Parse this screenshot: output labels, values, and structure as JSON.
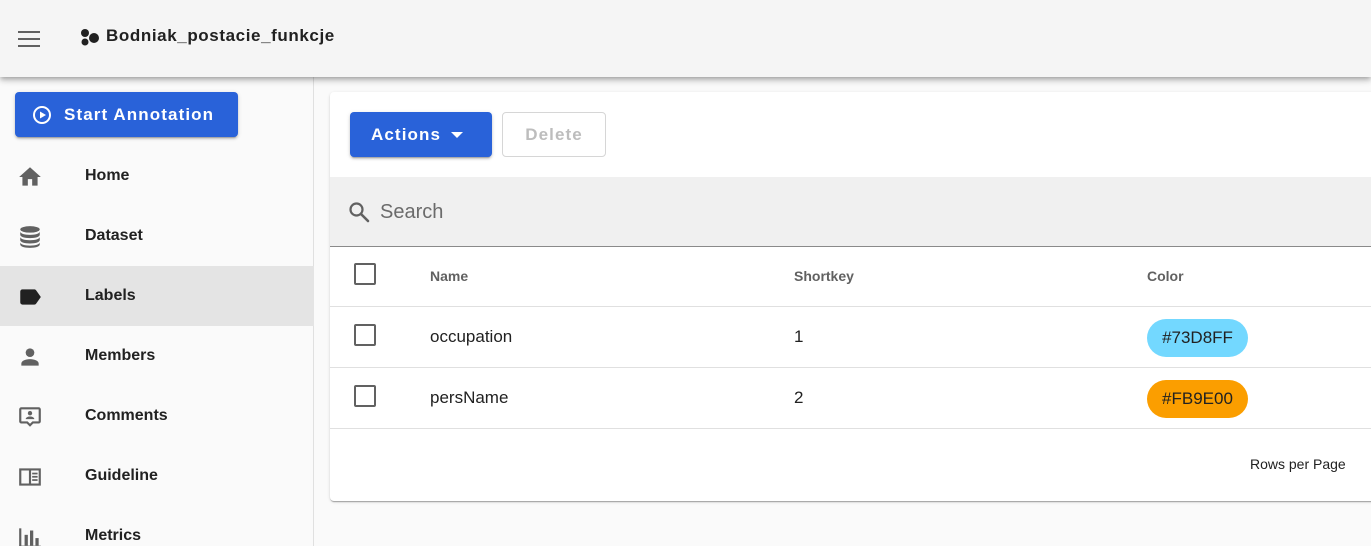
{
  "app": {
    "title": "Bodniak_postacie_funkcje"
  },
  "sidebar": {
    "start_button": "Start Annotation",
    "items": [
      {
        "label": "Home",
        "icon": "home-icon"
      },
      {
        "label": "Dataset",
        "icon": "database-icon"
      },
      {
        "label": "Labels",
        "icon": "label-icon",
        "active": true
      },
      {
        "label": "Members",
        "icon": "account-icon"
      },
      {
        "label": "Comments",
        "icon": "comment-icon"
      },
      {
        "label": "Guideline",
        "icon": "book-icon"
      },
      {
        "label": "Metrics",
        "icon": "chart-bar-icon"
      }
    ]
  },
  "toolbar": {
    "actions_label": "Actions",
    "delete_label": "Delete"
  },
  "search": {
    "placeholder": "Search",
    "value": ""
  },
  "table": {
    "columns": [
      "Name",
      "Shortkey",
      "Color"
    ],
    "rows": [
      {
        "name": "occupation",
        "shortkey": "1",
        "color": "#73D8FF"
      },
      {
        "name": "persName",
        "shortkey": "2",
        "color": "#FB9E00"
      }
    ]
  },
  "footer": {
    "rows_per_page_label": "Rows per Page"
  },
  "colors": {
    "primary": "#2962d9",
    "appbar": "#f5f5f5",
    "active_nav": "#e4e4e4"
  }
}
